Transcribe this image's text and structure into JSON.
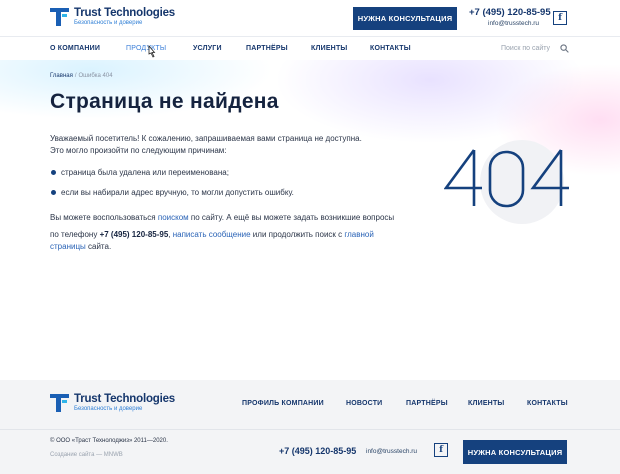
{
  "header": {
    "logo_name": "Trust Technologies",
    "logo_tagline": "Безопасность и доверие",
    "cta_label": "НУЖНА КОНСУЛЬТАЦИЯ",
    "phone": "+7 (495) 120-85-95",
    "email": "info@trusstech.ru",
    "social_icon": "facebook-icon"
  },
  "nav": {
    "items": [
      {
        "label": "О КОМПАНИИ"
      },
      {
        "label": "ПРОДУКТЫ"
      },
      {
        "label": "УСЛУГИ"
      },
      {
        "label": "ПАРТНЁРЫ"
      },
      {
        "label": "КЛИЕНТЫ"
      },
      {
        "label": "КОНТАКТЫ"
      }
    ],
    "active_item": "ПРОДУКТЫ",
    "search_placeholder": "Поиск по сайту"
  },
  "breadcrumb": {
    "home": "Главная",
    "separator": "/",
    "current": "Ошибка 404"
  },
  "main": {
    "title": "Страница не найдена",
    "intro_line1": "Уважаемый посетитель! К сожалению, запрашиваемая вами страница не доступна.",
    "intro_line2": "Это могло произойти по следующим причинам:",
    "reasons": [
      "страница была удалена или переименована;",
      "если вы набирали адрес вручную, то могли допустить ошибку."
    ],
    "outro_part1": "Вы можете воспользоваться ",
    "outro_link_search": "поиском",
    "outro_part2": " по сайту. А ещё вы можете задать возникшие вопросы",
    "outro_part3": "по телефону ",
    "outro_phone": "+7 (495) 120-85-95",
    "outro_part4": ", ",
    "outro_link_message": "написать сообщение",
    "outro_part5": " или продолжить поиск с ",
    "outro_link_home_a": "главной",
    "outro_link_home_b": "страницы",
    "outro_part6": " сайта.",
    "error_code": "404"
  },
  "footer": {
    "logo_name": "Trust Technologies",
    "logo_tagline": "Безопасность и доверие",
    "nav_items": [
      {
        "label": "ПРОФИЛЬ КОМПАНИИ"
      },
      {
        "label": "НОВОСТИ"
      },
      {
        "label": "ПАРТНЁРЫ"
      },
      {
        "label": "КЛИЕНТЫ"
      },
      {
        "label": "КОНТАКТЫ"
      }
    ],
    "copyright": "© ООО «Траст Технолоджиз» 2011—2020.",
    "made_by": "Создание сайта — MNWB",
    "phone": "+7 (495) 120-85-95",
    "email": "info@trusstech.ru",
    "cta_label": "НУЖНА КОНСУЛЬТАЦИЯ",
    "social_icon": "facebook-icon"
  },
  "colors": {
    "brand_dark": "#15417e",
    "link": "#2a63b6",
    "accent_light": "#2fb4e9"
  }
}
